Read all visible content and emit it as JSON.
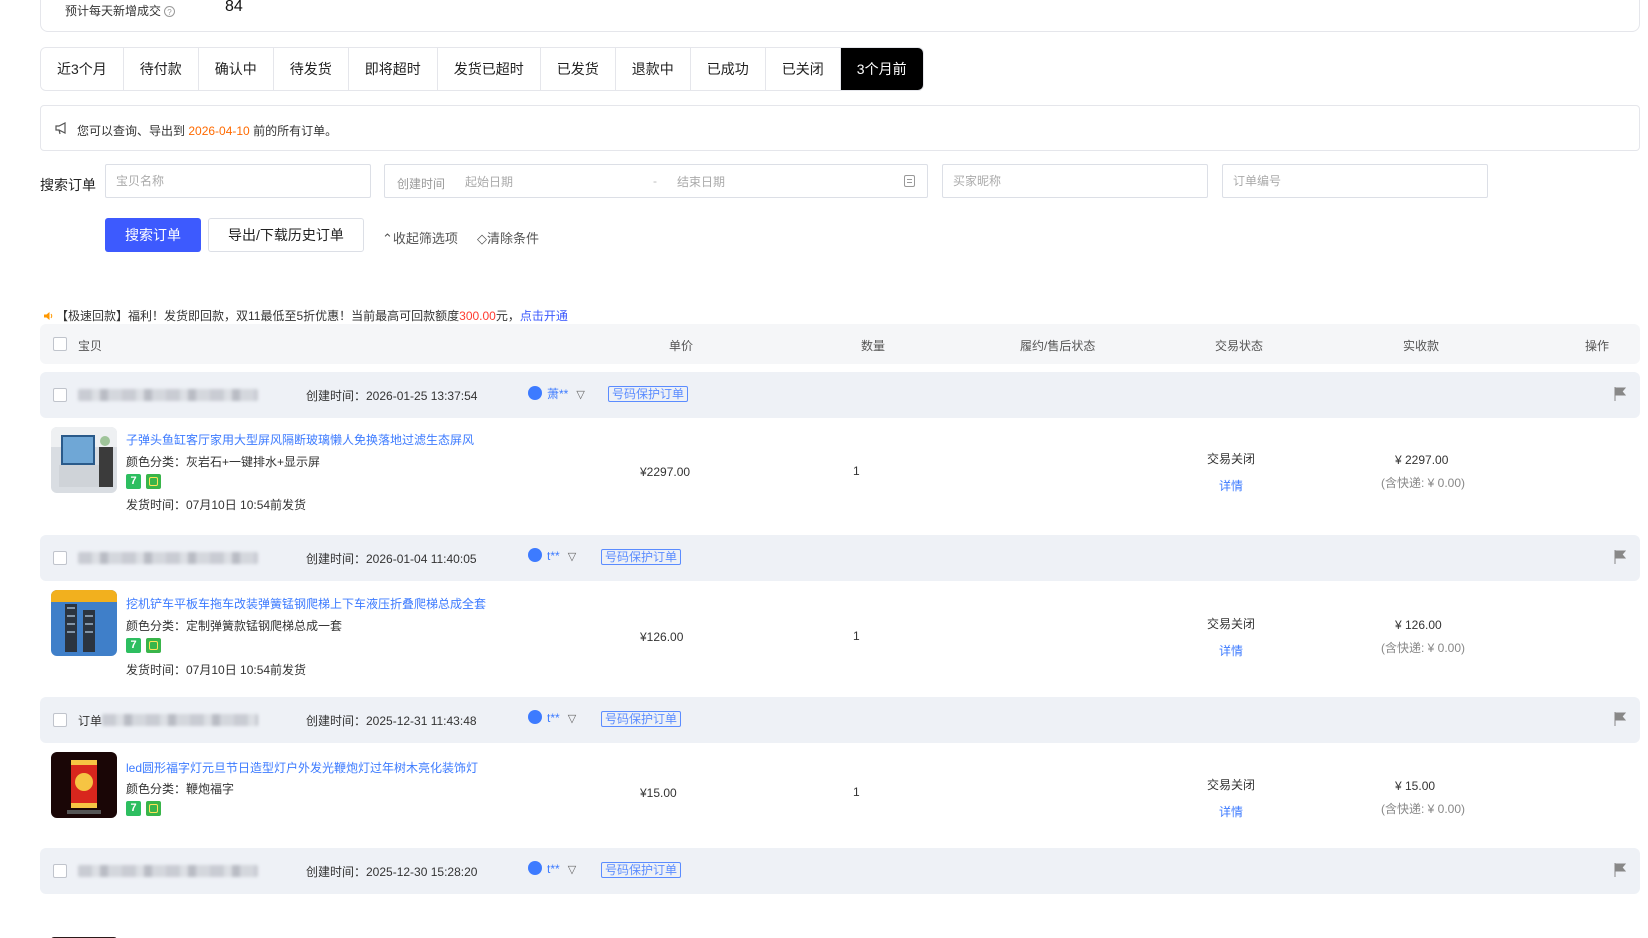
{
  "summary": {
    "label": "预计每天新增成交",
    "help_icon": "question-circle-icon",
    "value": "84"
  },
  "tabs": [
    "近3个月",
    "待付款",
    "确认中",
    "待发货",
    "即将超时",
    "发货已超时",
    "已发货",
    "退款中",
    "已成功",
    "已关闭",
    "3个月前"
  ],
  "active_tab": "3个月前",
  "notice": {
    "prefix": "您可以查询、导出到 ",
    "date": "2026-04-10",
    "suffix": " 前的所有订单。",
    "icon": "megaphone-icon"
  },
  "search": {
    "label": "搜索订单",
    "item_placeholder": "宝贝名称",
    "time_label": "创建时间",
    "start_placeholder": "起始日期",
    "dash": "-",
    "end_placeholder": "结束日期",
    "buyer_placeholder": "买家昵称",
    "order_placeholder": "订单编号",
    "search_button": "搜索订单",
    "export_button": "导出/下载历史订单",
    "collapse_link": "⌃收起筛选项",
    "clear_link": "◇清除条件"
  },
  "promo": {
    "icon": "speaker-icon",
    "text": "【极速回款】福利！发货即回款，双11最低至5折优惠！当前最高可回款额度",
    "amount": "300.00",
    "unit": "元，",
    "action": "点击开通"
  },
  "table_header": {
    "item": "宝贝",
    "price": "单价",
    "qty": "数量",
    "after_sale": "履约/售后状态",
    "trade_status": "交易状态",
    "received": "实收款",
    "action": "操作"
  },
  "orders": [
    {
      "created": "创建时间：2026-01-25 13:37:54",
      "buyer": "萧**",
      "protect_tag": "号码保护订单",
      "title": "子弹头鱼缸客厅家用大型屏风隔断玻璃懒人免换落地过滤生态屏风",
      "sku": "颜色分类：灰岩石+一键排水+显示屏",
      "ship": "发货时间：07月10日 10:54前发货",
      "price": "¥2297.00",
      "qty": "1",
      "status": "交易关闭",
      "detail": "详情",
      "paid": "¥ 2297.00",
      "post": "(含快递: ¥ 0.00)"
    },
    {
      "created": "创建时间：2026-01-04 11:40:05",
      "buyer": "t**",
      "protect_tag": "号码保护订单",
      "title": "挖机铲车平板车拖车改装弹簧锰钢爬梯上下车液压折叠爬梯总成全套",
      "sku": "颜色分类：定制弹簧款锰钢爬梯总成一套",
      "ship": "发货时间：07月10日 10:54前发货",
      "price": "¥126.00",
      "qty": "1",
      "status": "交易关闭",
      "detail": "详情",
      "paid": "¥ 126.00",
      "post": "(含快递: ¥ 0.00)"
    },
    {
      "created": "创建时间：2025-12-31 11:43:48",
      "buyer": "t**",
      "protect_tag": "号码保护订单",
      "head_prefix": "订单",
      "title": "led圆形福字灯元旦节日造型灯户外发光鞭炮灯过年树木亮化装饰灯",
      "sku": "颜色分类：鞭炮福字",
      "price": "¥15.00",
      "qty": "1",
      "status": "交易关闭",
      "detail": "详情",
      "paid": "¥ 15.00",
      "post": "(含快递: ¥ 0.00)"
    },
    {
      "created": "创建时间：2025-12-30 15:28:20",
      "buyer": "t**",
      "protect_tag": "号码保护订单"
    }
  ],
  "colors": {
    "accent": "#3d5afe",
    "link": "#3d7bff",
    "highlight": "#ff6a00",
    "amount": "#ff3b30",
    "active_tab_bg": "#000000"
  }
}
